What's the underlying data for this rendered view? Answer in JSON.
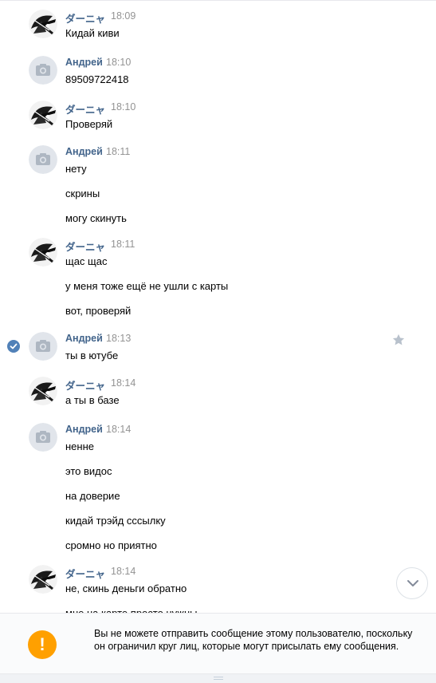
{
  "colors": {
    "author": "#42648b",
    "time": "#939393",
    "accent": "#5181b8",
    "warning": "#ffa000",
    "notice_bg": "#fafbfc"
  },
  "conversation": {
    "groups": [
      {
        "author": "ダーニャ",
        "time": "18:09",
        "avatar": "manga-avatar",
        "messages": [
          "Кидай киви"
        ]
      },
      {
        "author": "Андрей",
        "time": "18:10",
        "avatar": "camera-placeholder-avatar",
        "messages": [
          "89509722418"
        ]
      },
      {
        "author": "ダーニャ",
        "time": "18:10",
        "avatar": "manga-avatar",
        "messages": [
          "Проверяй"
        ]
      },
      {
        "author": "Андрей",
        "time": "18:11",
        "avatar": "camera-placeholder-avatar",
        "messages": [
          "нету",
          "скрины",
          "могу скинуть"
        ]
      },
      {
        "author": "ダーニャ",
        "time": "18:11",
        "avatar": "manga-avatar",
        "messages": [
          "щас щас",
          "у меня тоже ещё не ушли с карты",
          "вот, проверяй"
        ]
      },
      {
        "author": "Андрей",
        "time": "18:13",
        "avatar": "camera-placeholder-avatar",
        "messages": [
          "ты в ютубе"
        ],
        "selected": true,
        "star": true
      },
      {
        "author": "ダーニャ",
        "time": "18:14",
        "avatar": "manga-avatar",
        "messages": [
          "а ты в базе"
        ]
      },
      {
        "author": "Андрей",
        "time": "18:14",
        "avatar": "camera-placeholder-avatar",
        "messages": [
          "ненне",
          "это видос",
          "на доверие",
          "кидай трэйд сссылку",
          "сромно но приятно"
        ]
      },
      {
        "author": "ダーニャ",
        "time": "18:14",
        "avatar": "manga-avatar",
        "messages": [
          "не, скинь деньги обратно",
          "мне на карте просто нужны"
        ]
      }
    ]
  },
  "notice": {
    "icon": "exclamation-icon",
    "symbol": "!",
    "text": "Вы не можете отправить сообщение этому пользователю, поскольку он ограничил круг лиц, которые могут присылать ему сообщения."
  },
  "controls": {
    "scroll_down_icon": "chevron-down-icon",
    "star_icon": "star-icon",
    "check_icon": "checkmark-icon"
  }
}
